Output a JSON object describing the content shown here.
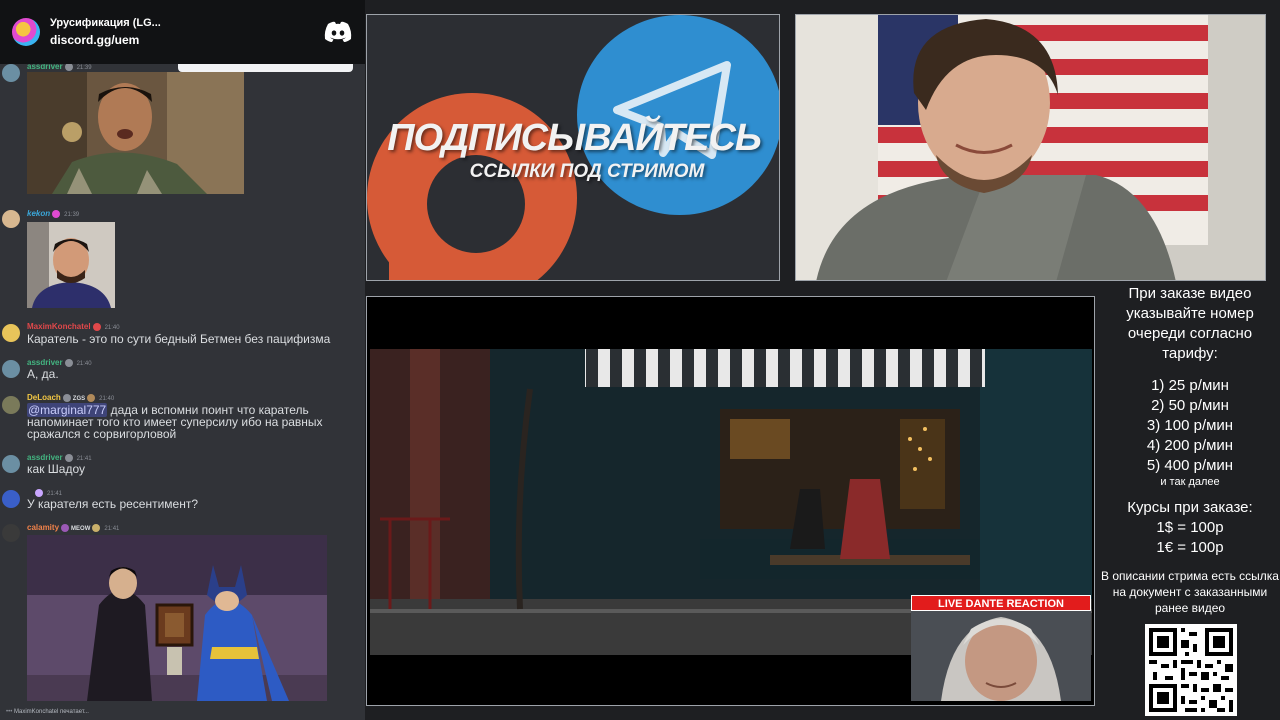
{
  "discord": {
    "server_name": "Урусификация (LG...",
    "invite": "discord.gg/uem",
    "typing": "MaximKonchatel печатает..."
  },
  "chat": [
    {
      "user": "assdriver",
      "time": "21:39",
      "color": "#43b581"
    },
    {
      "user": "kekon",
      "time": "21:39",
      "color": "#3ba7d9"
    },
    {
      "user": "MaximKonchatel",
      "time": "21:40",
      "color": "#e0484a",
      "text": "Каратель - это по сути бедный Бетмен без пацифизма"
    },
    {
      "user": "assdriver",
      "time": "21:40",
      "color": "#43b581",
      "text": "А, да."
    },
    {
      "user": "DeLoach",
      "tag": "ZGS",
      "time": "21:40",
      "color": "#f2c744",
      "mention": "@marginal777",
      "text": " дада и вспомни поинт что каратель напоминает того кто имеет суперсилу ибо на равных сражался с сорвигорловой"
    },
    {
      "user": "assdriver",
      "time": "21:41",
      "color": "#43b581",
      "text": "как Шадоу"
    },
    {
      "user": "",
      "time": "21:41",
      "color": "#c9a6ff",
      "text": "У карателя есть ресентимент?"
    },
    {
      "user": "calamity",
      "tag": "MEOW",
      "time": "21:41",
      "color": "#f0824a"
    }
  ],
  "promo": {
    "title": "ПОДПИСЫВАЙТЕСЬ",
    "subtitle": "ССЫЛКИ ПОД СТРИМОМ"
  },
  "video": {
    "overlay_label": "LIVE DANTE REACTION"
  },
  "info": {
    "order_text": "При заказе видео указывайте номер очереди согласно тарифу:",
    "tariffs": [
      "1) 25 р/мин",
      "2) 50 р/мин",
      "3) 100 р/мин",
      "4) 200 р/мин",
      "5) 400 р/мин"
    ],
    "and_so_on": "и так далее",
    "courses_title": "Курсы при заказе:",
    "usd": "1$ = 100р",
    "eur": "1€ = 100р",
    "note": "В описании стрима есть ссылка на документ с заказанными ранее видео"
  }
}
